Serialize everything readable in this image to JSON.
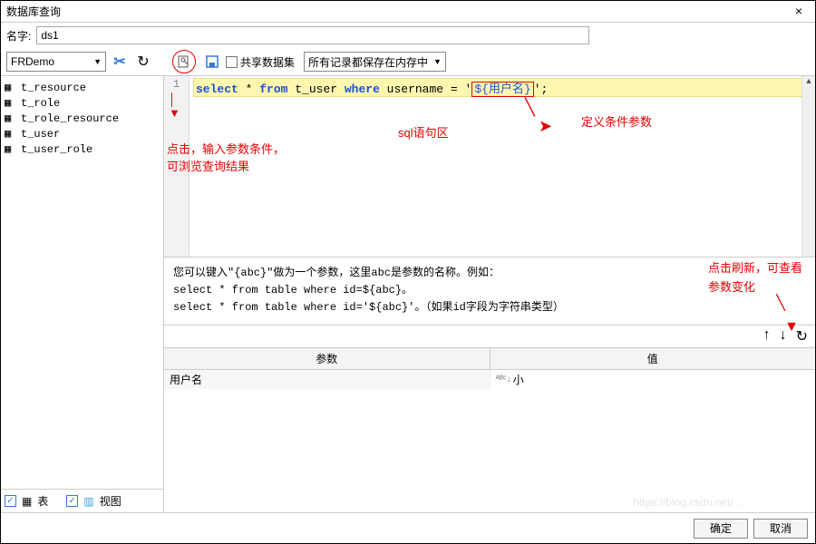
{
  "window": {
    "title": "数据库查询",
    "close": "×"
  },
  "name_row": {
    "label": "名字:",
    "value": "ds1"
  },
  "toolbar": {
    "datasource": "FRDemo",
    "share_label": "共享数据集",
    "records_combo": "所有记录都保存在内存中"
  },
  "tables": [
    {
      "name": "t_resource"
    },
    {
      "name": "t_role"
    },
    {
      "name": "t_role_resource"
    },
    {
      "name": "t_user"
    },
    {
      "name": "t_user_role"
    }
  ],
  "sidebar_bottom": {
    "table": "表",
    "view": "视图"
  },
  "sql": {
    "line_no": "1",
    "kw_select": "select",
    "star": " * ",
    "kw_from": "from",
    "table": " t_user ",
    "kw_where": "where",
    "col": " username = ",
    "q1": "'",
    "param": "${用户名}",
    "q2": "';"
  },
  "annotations": {
    "click_preview": "点击，输入参数条件，\n可浏览查询结果",
    "sql_area": "sql语句区",
    "define_param": "定义条件参数",
    "click_refresh": "点击刷新，可查看参数变化"
  },
  "hint": {
    "l1": "您可以键入\"{abc}\"做为一个参数，这里abc是参数的名称。例如：",
    "l2": "select * from table where id=${abc}。",
    "l3": "select * from table where id='${abc}'。（如果id字段为字符串类型）"
  },
  "param_table": {
    "head_param": "参数",
    "head_value": "值",
    "row_name": "用户名",
    "row_value": "小"
  },
  "footer": {
    "ok": "确定",
    "cancel": "取消"
  },
  "watermark": "https://blog.csdn.net/..."
}
